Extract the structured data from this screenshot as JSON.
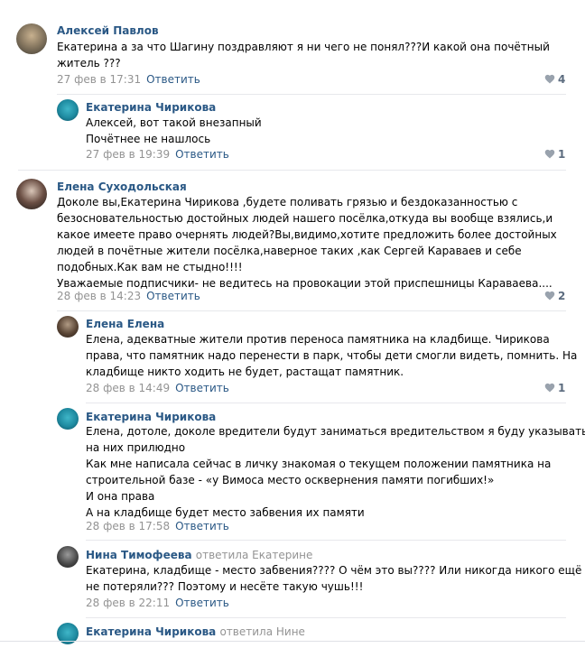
{
  "reply_label": "Ответить",
  "comments": [
    {
      "author": "Алексей Павлов",
      "lines": [
        "Екатерина а за что Шагину поздравляют я ни чего не понял???И какой она почётный",
        "житель ???"
      ],
      "date": "27 фев в 17:31",
      "likes": "4"
    },
    {
      "author": "Екатерина Чирикова",
      "lines": [
        "Алексей, вот такой внезапный",
        "Почётнее не нашлось"
      ],
      "date": "27 фев в 19:39",
      "likes": "1"
    },
    {
      "author": "Елена Суходольская",
      "lines": [
        "Доколе вы,Екатерина Чирикова ,будете поливать грязью и бездоказанностью с",
        "безосновательностью достойных людей нашего посёлка,откуда вы вообще взялись,и",
        "какое имеете право очернять людей?Вы,видимо,хотите предложить более достойных",
        "людей в почётные жители посёлка,наверное таких ,как Сергей Караваев и себе",
        "подобных.Как вам не стыдно!!!!",
        "Уважаемые подписчики- не ведитесь на провокации этой приспешницы Караваева...."
      ],
      "date": "28 фев в 14:23",
      "likes": "2"
    },
    {
      "author": "Елена Елена",
      "lines": [
        "Елена, адекватные жители против переноса памятника на кладбище. Чирикова",
        "права, что памятник надо перенести в парк, чтобы дети смогли видеть, помнить. На",
        "кладбище никто ходить не будет, растащат памятник."
      ],
      "date": "28 фев в 14:49",
      "likes": "1"
    },
    {
      "author": "Екатерина Чирикова",
      "lines": [
        "Елена, дотоле, доколе вредители будут заниматься вредительством я буду указывать",
        "на них прилюдно",
        "Как мне написала сейчас в личку знакомая о текущем положении памятника на",
        "строительной базе - «у Вимоса место осквернения памяти погибших!»",
        "И она права",
        "А на кладбище будет место забвения их памяти"
      ],
      "date": "28 фев в 17:58",
      "likes": ""
    },
    {
      "author": "Нина Тимофеева",
      "reply_to": "ответила Екатерине",
      "lines": [
        "Екатерина, кладбище - место забвения???? О чём это вы???? Или никогда никого ещё",
        "не потеряли??? Поэтому и несёте такую чушь!!!"
      ],
      "date": "28 фев в 22:11",
      "likes": ""
    },
    {
      "author": "Екатерина Чирикова",
      "reply_to": "ответила Нине",
      "lines": [],
      "date": "",
      "likes": ""
    }
  ],
  "colors": {
    "link": "#2a5885",
    "muted": "#939393",
    "divider": "#e7e8ec",
    "like": "#99a2ad"
  }
}
